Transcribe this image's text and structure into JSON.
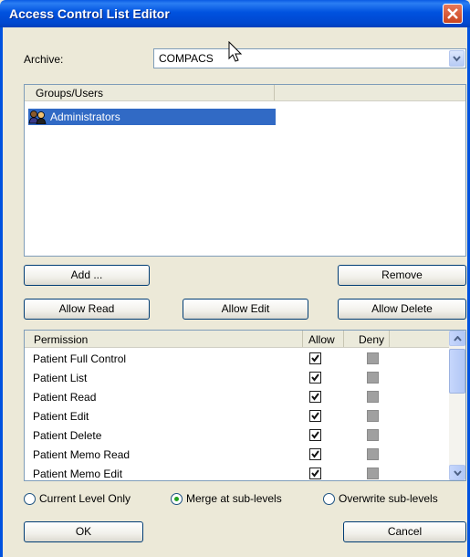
{
  "window": {
    "title": "Access Control List Editor"
  },
  "archive": {
    "label": "Archive:",
    "value": "COMPACS"
  },
  "groups": {
    "header": "Groups/Users",
    "items": [
      {
        "label": "Administrators",
        "icon": "group-users-icon",
        "selected": true
      }
    ]
  },
  "buttons": {
    "add": "Add ...",
    "remove": "Remove",
    "allow_read": "Allow Read",
    "allow_edit": "Allow Edit",
    "allow_delete": "Allow Delete",
    "ok": "OK",
    "cancel": "Cancel"
  },
  "permissions": {
    "headers": {
      "permission": "Permission",
      "allow": "Allow",
      "deny": "Deny"
    },
    "rows": [
      {
        "name": "Patient Full Control",
        "allow": true,
        "deny": false
      },
      {
        "name": "Patient List",
        "allow": true,
        "deny": false
      },
      {
        "name": "Patient Read",
        "allow": true,
        "deny": false
      },
      {
        "name": "Patient Edit",
        "allow": true,
        "deny": false
      },
      {
        "name": "Patient Delete",
        "allow": true,
        "deny": false
      },
      {
        "name": "Patient Memo Read",
        "allow": true,
        "deny": false
      },
      {
        "name": "Patient Memo Edit",
        "allow": true,
        "deny": false
      }
    ]
  },
  "options": {
    "current_level_only": "Current Level Only",
    "merge_sub_levels": "Merge at sub-levels",
    "overwrite_sub_levels": "Overwrite sub-levels",
    "selected": "merge_sub_levels"
  },
  "colors": {
    "title_blue": "#0052df",
    "selection": "#316ac5",
    "radio_green": "#21a121",
    "dialog_bg": "#ece9d8"
  }
}
